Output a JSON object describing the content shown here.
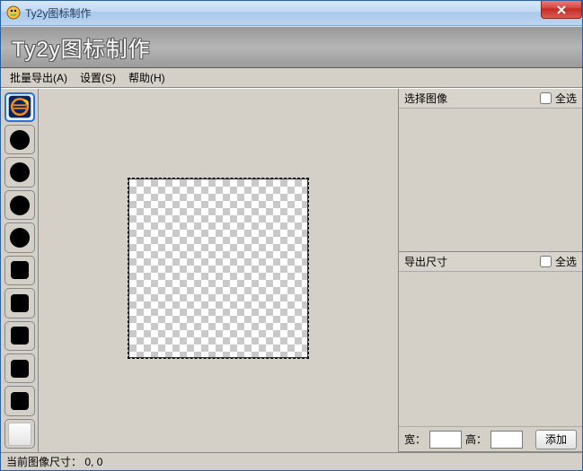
{
  "window": {
    "title": "Ty2y图标制作"
  },
  "header": {
    "title": "Ty2y图标制作"
  },
  "menu": {
    "batch_export": "批量导出(A)",
    "settings": "设置(S)",
    "help": "帮助(H)"
  },
  "right": {
    "select_image": {
      "title": "选择图像",
      "select_all": "全选"
    },
    "export_size": {
      "title": "导出尺寸",
      "select_all": "全选",
      "width_label": "宽：",
      "height_label": "高：",
      "width_value": "",
      "height_value": "",
      "add_label": "添加"
    }
  },
  "status": {
    "label": "当前图像尺寸：",
    "value": "0, 0"
  },
  "thumbs": [
    {
      "kind": "app",
      "selected": true
    },
    {
      "kind": "circle",
      "selected": false
    },
    {
      "kind": "circle",
      "selected": false
    },
    {
      "kind": "circle",
      "selected": false
    },
    {
      "kind": "circle",
      "selected": false
    },
    {
      "kind": "round",
      "selected": false
    },
    {
      "kind": "round",
      "selected": false
    },
    {
      "kind": "round",
      "selected": false
    },
    {
      "kind": "round",
      "selected": false
    },
    {
      "kind": "round",
      "selected": false
    },
    {
      "kind": "empty",
      "selected": false
    }
  ]
}
